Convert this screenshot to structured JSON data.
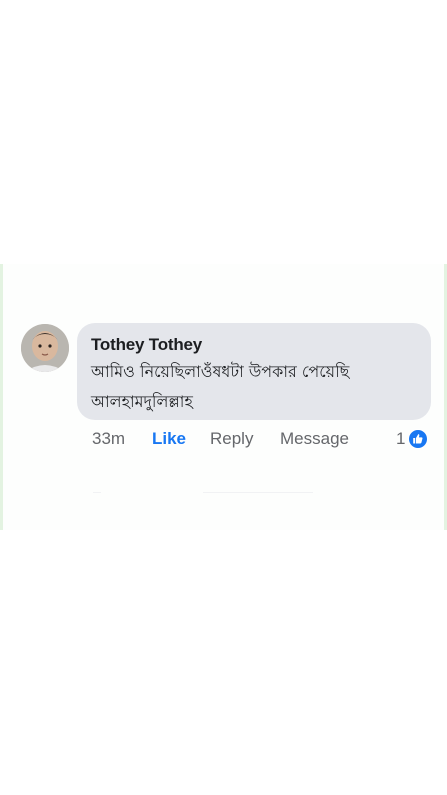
{
  "comment": {
    "author": "Tothey Tothey",
    "text": "আমিও নিয়েছিলাওঁষধটা উপকার পেয়েছি আলহামদুলিল্লাহ"
  },
  "actions": {
    "time": "33m",
    "like_label": "Like",
    "reply_label": "Reply",
    "message_label": "Message",
    "reaction_count": "1"
  },
  "colors": {
    "like_blue": "#1877f2",
    "bubble_gray": "#e4e6eb",
    "meta_gray": "#65676b"
  },
  "icons": {
    "reaction": "thumbs-up-icon"
  }
}
